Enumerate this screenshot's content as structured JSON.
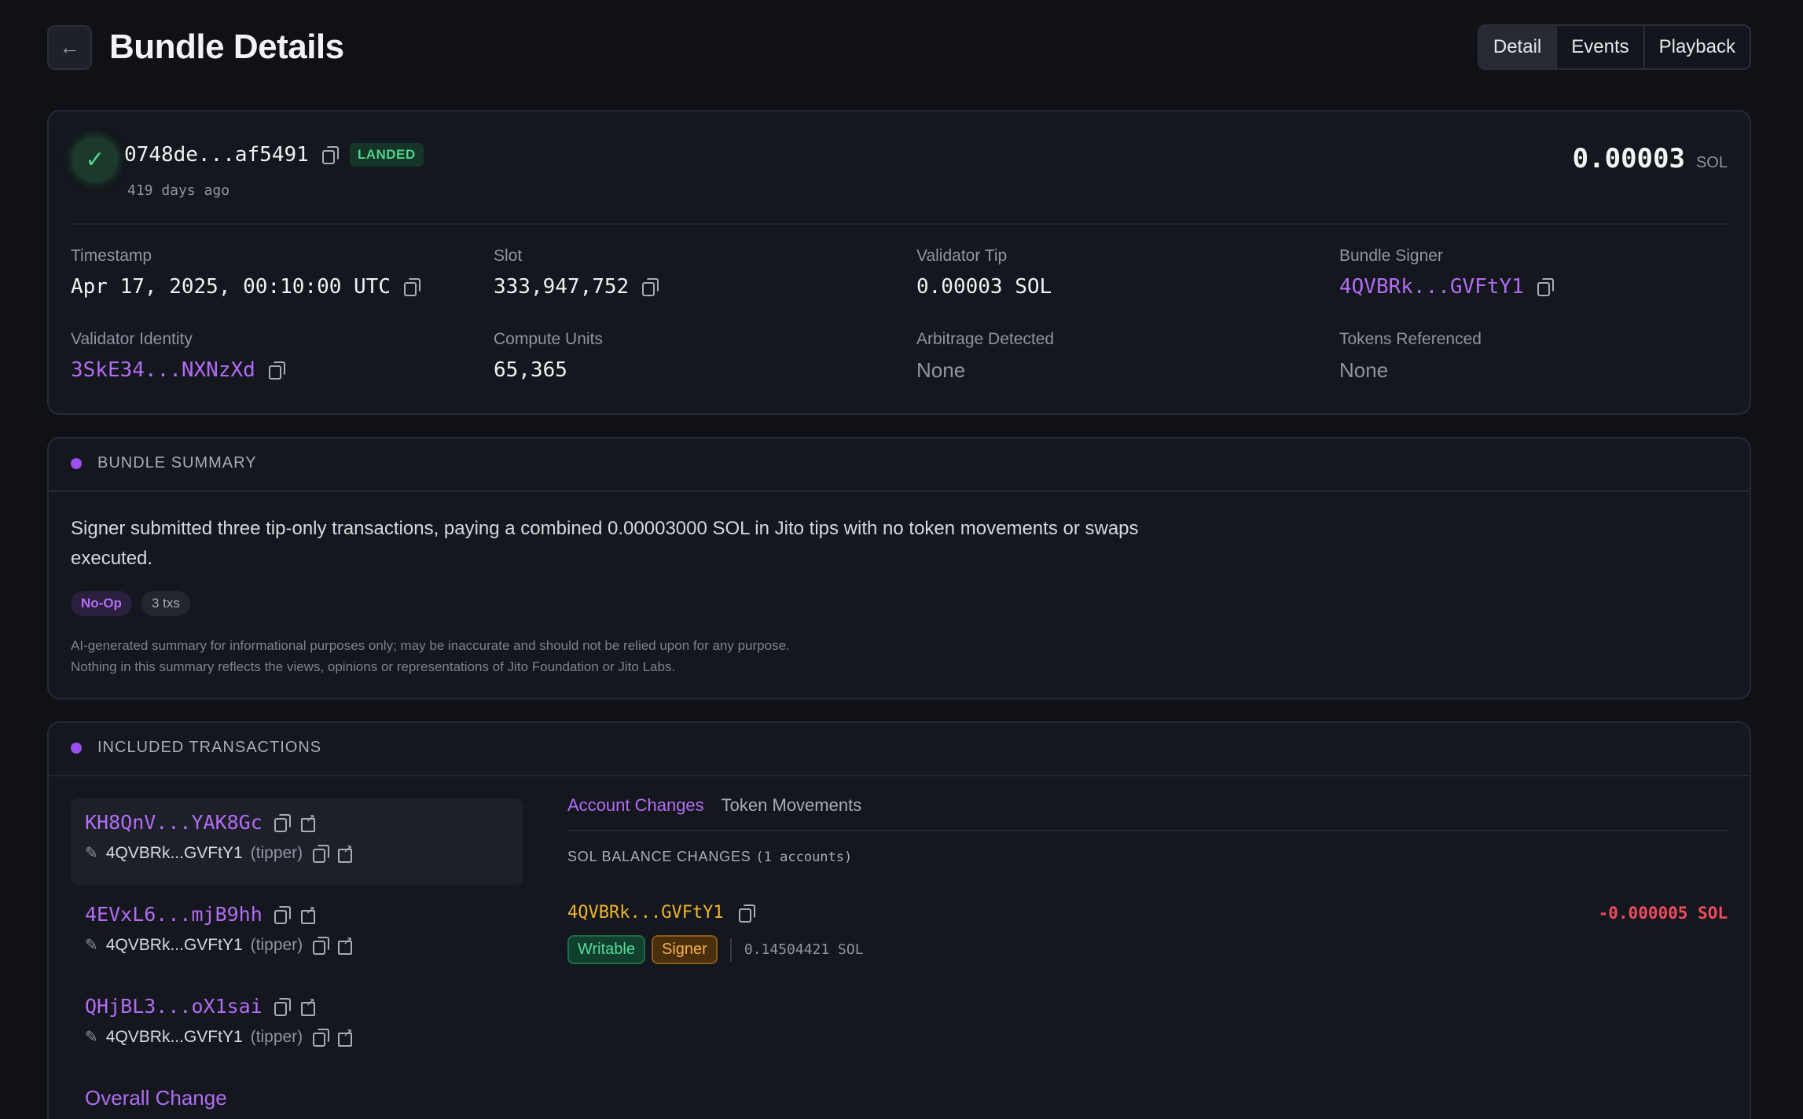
{
  "header": {
    "title": "Bundle Details",
    "back_icon": "arrow-left-icon",
    "tabs": [
      {
        "label": "Detail",
        "active": true
      },
      {
        "label": "Events",
        "active": false
      },
      {
        "label": "Playback",
        "active": false
      }
    ]
  },
  "bundle": {
    "id": "0748de...af5491",
    "status": "LANDED",
    "age": "419 days ago",
    "amount": "0.00003",
    "amount_unit": "SOL",
    "fields": {
      "timestamp": {
        "label": "Timestamp",
        "value": "Apr 17, 2025, 00:10:00 UTC"
      },
      "slot": {
        "label": "Slot",
        "value": "333,947,752"
      },
      "validator_tip": {
        "label": "Validator Tip",
        "value": "0.00003 SOL"
      },
      "bundle_signer": {
        "label": "Bundle Signer",
        "value": "4QVBRk...GVFtY1"
      },
      "validator_identity": {
        "label": "Validator Identity",
        "value": "3SkE34...NXNzXd"
      },
      "compute_units": {
        "label": "Compute Units",
        "value": "65,365"
      },
      "arbitrage_detected": {
        "label": "Arbitrage Detected",
        "value": "None"
      },
      "tokens_referenced": {
        "label": "Tokens Referenced",
        "value": "None"
      }
    }
  },
  "summary": {
    "title": "BUNDLE SUMMARY",
    "text": "Signer submitted three tip-only transactions, paying a combined 0.00003000 SOL in Jito tips with no token movements or swaps executed.",
    "tags": [
      "No-Op",
      "3 txs"
    ],
    "disclaimer_line1": "AI-generated summary for informational purposes only; may be inaccurate and should not be relied upon for any purpose.",
    "disclaimer_line2": "Nothing in this summary reflects the views, opinions or representations of Jito Foundation or Jito Labs."
  },
  "transactions": {
    "title": "INCLUDED TRANSACTIONS",
    "items": [
      {
        "signature": "KH8QnV...YAK8Gc",
        "signer": "4QVBRk...GVFtY1",
        "role": "(tipper)",
        "selected": true
      },
      {
        "signature": "4EVxL6...mjB9hh",
        "signer": "4QVBRk...GVFtY1",
        "role": "(tipper)",
        "selected": false
      },
      {
        "signature": "QHjBL3...oX1sai",
        "signer": "4QVBRk...GVFtY1",
        "role": "(tipper)",
        "selected": false
      }
    ],
    "overall_change": "Overall Change",
    "detail": {
      "tabs": [
        {
          "label": "Account Changes",
          "active": true
        },
        {
          "label": "Token Movements",
          "active": false
        }
      ],
      "sol_head": "SOL BALANCE CHANGES",
      "sol_count": "(1 accounts)",
      "account": {
        "address": "4QVBRk...GVFtY1",
        "delta": "-0.000005 SOL",
        "flags": [
          "Writable",
          "Signer"
        ],
        "balance": "0.14504421 SOL"
      }
    }
  },
  "colors": {
    "accent": "#b36cf4",
    "success": "#4fd18b",
    "warning": "#f0b429",
    "danger": "#f04b5f",
    "background": "#0f1116"
  }
}
